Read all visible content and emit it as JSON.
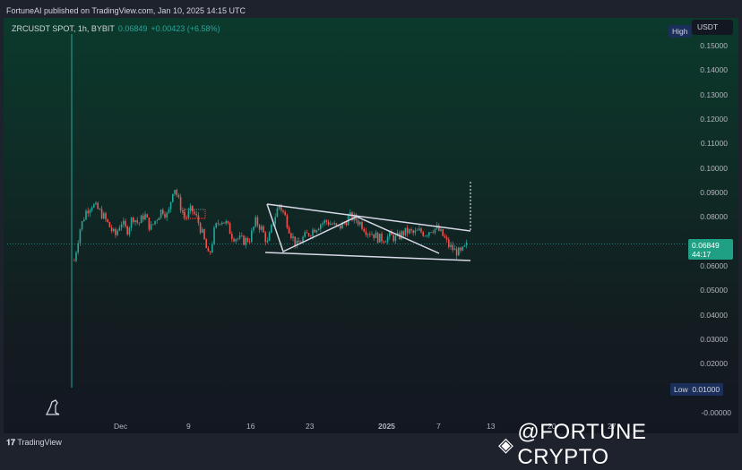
{
  "header": {
    "published": "FortuneAI published on TradingView.com, Jan 10, 2025 14:15 UTC"
  },
  "symbol": {
    "name": "ZRCUSDT SPOT, 1h, BYBIT",
    "price": "0.06849",
    "change": "+0.00423 (+6.58%)"
  },
  "price_axis": {
    "currency": "USDT",
    "labels": [
      "0.15000",
      "0.14000",
      "0.13000",
      "0.12000",
      "0.11000",
      "0.10000",
      "0.09000",
      "0.08000",
      "0.06000",
      "0.05000",
      "0.04000",
      "0.03000",
      "0.02000",
      "-0.00000"
    ],
    "high_label": "High",
    "low_label": "Low",
    "low_value": "0.01000",
    "current_price": "0.06849",
    "countdown": "44:17"
  },
  "time_axis": {
    "labels": [
      "Dec",
      "9",
      "16",
      "23",
      "2025",
      "7",
      "13",
      "20",
      "27"
    ]
  },
  "series": {
    "closes": [
      0.062,
      0.075,
      0.082,
      0.085,
      0.083,
      0.08,
      0.076,
      0.072,
      0.078,
      0.074,
      0.08,
      0.077,
      0.081,
      0.075,
      0.079,
      0.083,
      0.08,
      0.093,
      0.085,
      0.079,
      0.083,
      0.079,
      0.072,
      0.063,
      0.075,
      0.079,
      0.077,
      0.072,
      0.071,
      0.07,
      0.071,
      0.078,
      0.075,
      0.069,
      0.078,
      0.085,
      0.08,
      0.073,
      0.068,
      0.071,
      0.073,
      0.075,
      0.077,
      0.078,
      0.077,
      0.075,
      0.077,
      0.08,
      0.079,
      0.077,
      0.074,
      0.073,
      0.071,
      0.071,
      0.072,
      0.071,
      0.073,
      0.074,
      0.073,
      0.074,
      0.073,
      0.075,
      0.075,
      0.072,
      0.068,
      0.066,
      0.065,
      0.068
    ]
  },
  "colors": {
    "up": "#26a69a",
    "down": "#ef5350",
    "lines": "#d8d8e8"
  },
  "footer": {
    "brand": "TradingView",
    "watermark": "@FORTUNE CRYPTO"
  }
}
